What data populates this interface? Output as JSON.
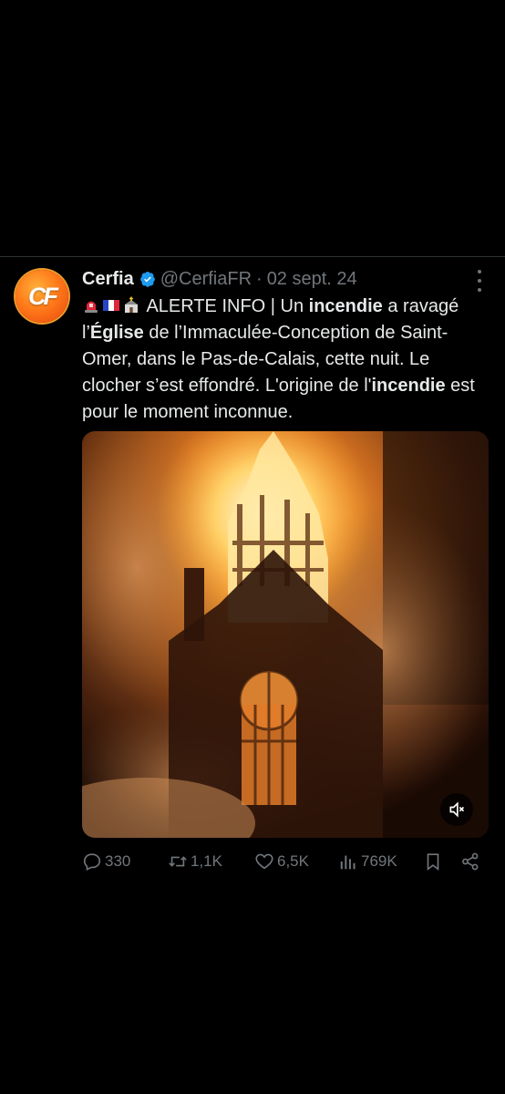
{
  "tweet": {
    "avatar_text": "CF",
    "name": "Cerfia",
    "handle": "@CerfiaFR",
    "separator": "·",
    "date": "02 sept. 24",
    "text": {
      "alert": "ALERTE INFO | Un ",
      "w1": "incendie",
      "p2": " a ravagé l’",
      "w2": "Église",
      "p3": " de l’Immaculée-Conception de Saint-Omer, dans le Pas-de-Calais, cette nuit. Le clocher s’est effondré. L'origine de l'",
      "w3": "incendie",
      "p4": " est pour le moment inconnue."
    },
    "emojis": [
      "rotating-light-icon",
      "france-flag-icon",
      "church-icon"
    ]
  },
  "stats": {
    "replies": "330",
    "reposts": "1,1K",
    "likes": "6,5K",
    "views": "769K"
  },
  "colors": {
    "background": "#000000",
    "text": "#e7e9ea",
    "muted": "#71767b",
    "verified": "#1d9bf0",
    "divider": "#2f3336"
  }
}
